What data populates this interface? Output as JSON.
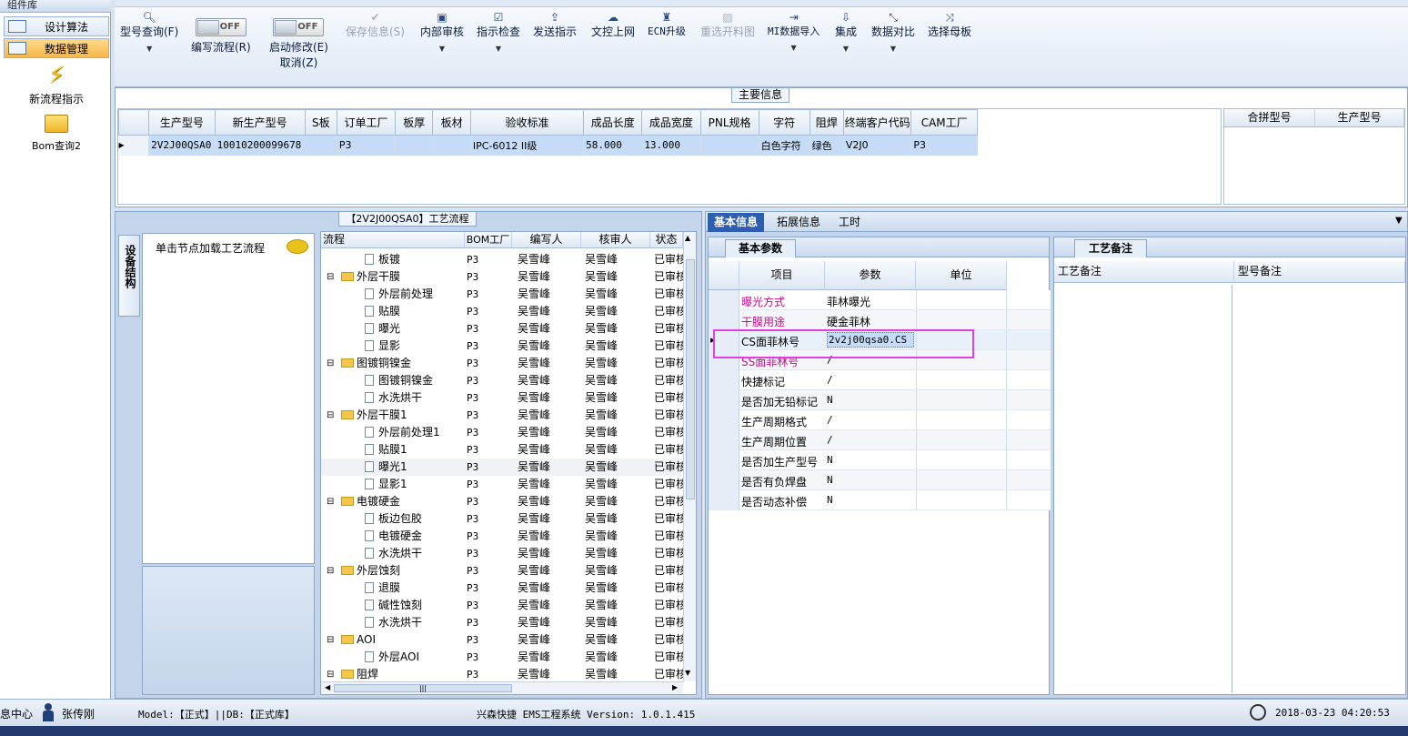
{
  "nav": {
    "header": "组件库",
    "items": [
      {
        "label": "设计算法",
        "selected": false
      },
      {
        "label": "数据管理",
        "selected": true
      }
    ],
    "tools": [
      {
        "label": "新流程指示",
        "icon": "lightning-icon"
      },
      {
        "label": "Bom查询2",
        "icon": "folder-icon"
      }
    ]
  },
  "toolbar": {
    "model_query": "型号查询(F)",
    "edit_flow": "编写流程(R)",
    "start_modify": "启动修改(E)",
    "cancel": "取消(Z)",
    "toggle_off": "OFF",
    "save_info": "保存信息(S)",
    "internal_audit": "内部审核",
    "indicator_check": "指示检查",
    "send_indicator": "发送指示",
    "file_upload": "文控上网",
    "ecn_upgrade": "ECN升级",
    "reselect_cutting": "重选开料图",
    "mi_import": "MI数据导入",
    "integrate": "集成",
    "data_compare": "数据对比",
    "select_mother": "选择母板"
  },
  "main_info": {
    "title": "主要信息",
    "columns": [
      "生产型号",
      "新生产型号",
      "S板",
      "订单工厂",
      "板厚",
      "板材",
      "验收标准",
      "成品长度",
      "成品宽度",
      "PNL规格",
      "字符",
      "阻焊",
      "终端客户代码",
      "CAM工厂"
    ],
    "row": [
      "2V2J00QSA0",
      "10010200099678",
      "",
      "P3",
      "",
      "",
      "IPC-6012 II级",
      "58.000",
      "13.000",
      "",
      "白色字符",
      "绿色",
      "V2J0",
      "P3"
    ],
    "side_columns": [
      "合拼型号",
      "生产型号"
    ]
  },
  "process": {
    "title": "【2V2J00QSA0】工艺流程",
    "side_tab": "设备结构",
    "hint": "单击节点加载工艺流程",
    "columns": [
      "流程",
      "BOM工厂",
      "编写人",
      "核审人",
      "状态"
    ],
    "rows": [
      {
        "name": "板镀",
        "level": 2,
        "type": "doc",
        "bom": "P3",
        "writer": "吴雪峰",
        "reviewer": "吴雪峰",
        "status": "已审核"
      },
      {
        "name": "外层干膜",
        "level": 1,
        "type": "folder",
        "bom": "P3",
        "writer": "吴雪峰",
        "reviewer": "吴雪峰",
        "status": "已审核"
      },
      {
        "name": "外层前处理",
        "level": 2,
        "type": "doc",
        "bom": "P3",
        "writer": "吴雪峰",
        "reviewer": "吴雪峰",
        "status": "已审核"
      },
      {
        "name": "贴膜",
        "level": 2,
        "type": "doc",
        "bom": "P3",
        "writer": "吴雪峰",
        "reviewer": "吴雪峰",
        "status": "已审核"
      },
      {
        "name": "曝光",
        "level": 2,
        "type": "doc",
        "bom": "P3",
        "writer": "吴雪峰",
        "reviewer": "吴雪峰",
        "status": "已审核"
      },
      {
        "name": "显影",
        "level": 2,
        "type": "doc",
        "bom": "P3",
        "writer": "吴雪峰",
        "reviewer": "吴雪峰",
        "status": "已审核"
      },
      {
        "name": "图镀铜镍金",
        "level": 1,
        "type": "folder",
        "bom": "P3",
        "writer": "吴雪峰",
        "reviewer": "吴雪峰",
        "status": "已审核"
      },
      {
        "name": "图镀铜镍金",
        "level": 2,
        "type": "doc",
        "bom": "P3",
        "writer": "吴雪峰",
        "reviewer": "吴雪峰",
        "status": "已审核"
      },
      {
        "name": "水洗烘干",
        "level": 2,
        "type": "doc",
        "bom": "P3",
        "writer": "吴雪峰",
        "reviewer": "吴雪峰",
        "status": "已审核"
      },
      {
        "name": "外层干膜1",
        "level": 1,
        "type": "folder",
        "bom": "P3",
        "writer": "吴雪峰",
        "reviewer": "吴雪峰",
        "status": "已审核"
      },
      {
        "name": "外层前处理1",
        "level": 2,
        "type": "doc",
        "bom": "P3",
        "writer": "吴雪峰",
        "reviewer": "吴雪峰",
        "status": "已审核"
      },
      {
        "name": "贴膜1",
        "level": 2,
        "type": "doc",
        "bom": "P3",
        "writer": "吴雪峰",
        "reviewer": "吴雪峰",
        "status": "已审核"
      },
      {
        "name": "曝光1",
        "level": 2,
        "type": "doc",
        "bom": "P3",
        "writer": "吴雪峰",
        "reviewer": "吴雪峰",
        "status": "已审核"
      },
      {
        "name": "显影1",
        "level": 2,
        "type": "doc",
        "bom": "P3",
        "writer": "吴雪峰",
        "reviewer": "吴雪峰",
        "status": "已审核"
      },
      {
        "name": "电镀硬金",
        "level": 1,
        "type": "folder",
        "bom": "P3",
        "writer": "吴雪峰",
        "reviewer": "吴雪峰",
        "status": "已审核"
      },
      {
        "name": "板边包胶",
        "level": 2,
        "type": "doc",
        "bom": "P3",
        "writer": "吴雪峰",
        "reviewer": "吴雪峰",
        "status": "已审核"
      },
      {
        "name": "电镀硬金",
        "level": 2,
        "type": "doc",
        "bom": "P3",
        "writer": "吴雪峰",
        "reviewer": "吴雪峰",
        "status": "已审核"
      },
      {
        "name": "水洗烘干",
        "level": 2,
        "type": "doc",
        "bom": "P3",
        "writer": "吴雪峰",
        "reviewer": "吴雪峰",
        "status": "已审核"
      },
      {
        "name": "外层蚀刻",
        "level": 1,
        "type": "folder",
        "bom": "P3",
        "writer": "吴雪峰",
        "reviewer": "吴雪峰",
        "status": "已审核"
      },
      {
        "name": "退膜",
        "level": 2,
        "type": "doc",
        "bom": "P3",
        "writer": "吴雪峰",
        "reviewer": "吴雪峰",
        "status": "已审核"
      },
      {
        "name": "碱性蚀刻",
        "level": 2,
        "type": "doc",
        "bom": "P3",
        "writer": "吴雪峰",
        "reviewer": "吴雪峰",
        "status": "已审核"
      },
      {
        "name": "水洗烘干",
        "level": 2,
        "type": "doc",
        "bom": "P3",
        "writer": "吴雪峰",
        "reviewer": "吴雪峰",
        "status": "已审核"
      },
      {
        "name": "AOI",
        "level": 1,
        "type": "folder",
        "bom": "P3",
        "writer": "吴雪峰",
        "reviewer": "吴雪峰",
        "status": "已审核"
      },
      {
        "name": "外层AOI",
        "level": 2,
        "type": "doc",
        "bom": "P3",
        "writer": "吴雪峰",
        "reviewer": "吴雪峰",
        "status": "已审核"
      },
      {
        "name": "阻焊",
        "level": 1,
        "type": "folder",
        "bom": "P3",
        "writer": "吴雪峰",
        "reviewer": "吴雪峰",
        "status": "已审核"
      }
    ],
    "scroll_mark": "|||"
  },
  "detail": {
    "tabs": [
      "基本信息",
      "拓展信息",
      "工时"
    ],
    "basic_tab": "基本参数",
    "columns": [
      "项目",
      "参数",
      "单位"
    ],
    "rows": [
      {
        "item": "曝光方式",
        "value": "菲林曝光",
        "unit": "",
        "highlight": true
      },
      {
        "item": "干膜用途",
        "value": "硬金菲林",
        "unit": "",
        "highlight": true
      },
      {
        "item": "CS面菲林号",
        "value": "2v2j00qsa0.CS",
        "unit": "",
        "highlight": false
      },
      {
        "item": "SS面菲林号",
        "value": "/",
        "unit": "",
        "highlight": true
      },
      {
        "item": "快捷标记",
        "value": "/",
        "unit": "",
        "highlight": false
      },
      {
        "item": "是否加无铅标记",
        "value": "N",
        "unit": "",
        "highlight": false
      },
      {
        "item": "生产周期格式",
        "value": "/",
        "unit": "",
        "highlight": false
      },
      {
        "item": "生产周期位置",
        "value": "/",
        "unit": "",
        "highlight": false
      },
      {
        "item": "是否加生产型号",
        "value": "N",
        "unit": "",
        "highlight": false
      },
      {
        "item": "是否有负焊盘",
        "value": "N",
        "unit": "",
        "highlight": false
      },
      {
        "item": "是否动态补偿",
        "value": "N",
        "unit": "",
        "highlight": false
      }
    ],
    "remark_tab": "工艺备注",
    "remark_columns": [
      "工艺备注",
      "型号备注"
    ]
  },
  "status": {
    "center": "息中心",
    "user": "张传刚",
    "model": "Model:【正式】||DB:【正式库】",
    "app": "兴森快捷 EMS工程系统 Version: 1.0.1.415",
    "datetime": "2018-03-23 04:20:53"
  },
  "colors": {
    "highlight_text": "#c0108a",
    "selected_row": "#c6dcf6",
    "annotation_box": "#e040e0"
  }
}
